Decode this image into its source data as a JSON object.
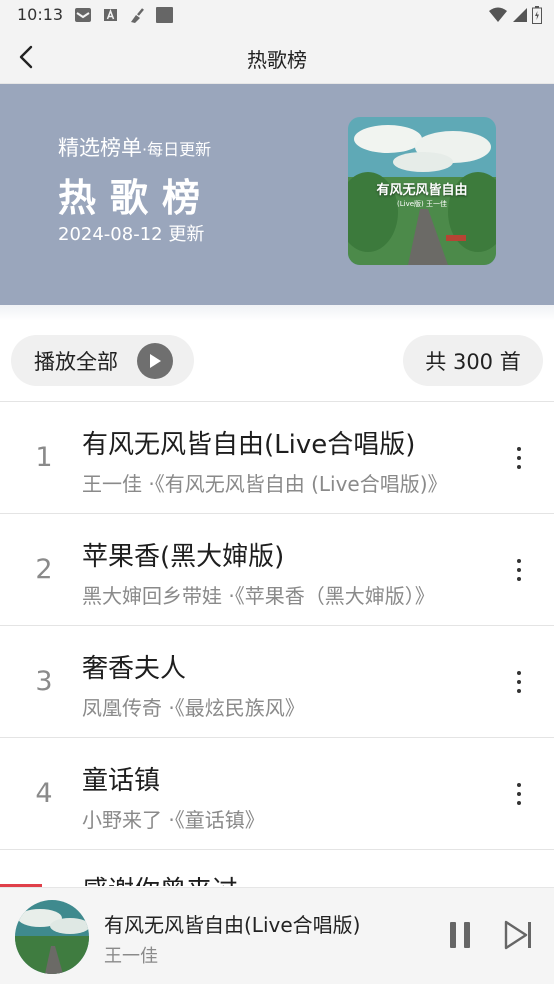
{
  "status_bar": {
    "time": "10:13"
  },
  "nav": {
    "title": "热歌榜"
  },
  "banner": {
    "subtitle": "精选榜单",
    "subtitle_dot": "·",
    "subtitle_small": "每日更新",
    "title": "热歌榜",
    "date": "2024-08-12 更新",
    "cover_title": "有风无风皆自由",
    "cover_subtitle": "(Live版) 王一佳"
  },
  "actions": {
    "play_all": "播放全部",
    "count": "共 300 首"
  },
  "songs": [
    {
      "num": "1",
      "title": "有风无风皆自由(Live合唱版)",
      "sub": "王一佳 ·《有风无风皆自由 (Live合唱版)》"
    },
    {
      "num": "2",
      "title": "苹果香(黑大婶版)",
      "sub": "黑大婶回乡带娃 ·《苹果香（黑大婶版）》"
    },
    {
      "num": "3",
      "title": "奢香夫人",
      "sub": "凤凰传奇 ·《最炫民族风》"
    },
    {
      "num": "4",
      "title": "童话镇",
      "sub": "小野来了 ·《童话镇》"
    }
  ],
  "partial_song_title": "感谢你曾来过",
  "player": {
    "title": "有风无风皆自由(Live合唱版)",
    "artist": "王一佳",
    "progress": 0.076
  },
  "colors": {
    "banner_bg": "#9aa6bc",
    "progress": "#e0404a",
    "pill_bg": "#f0f0f0"
  }
}
